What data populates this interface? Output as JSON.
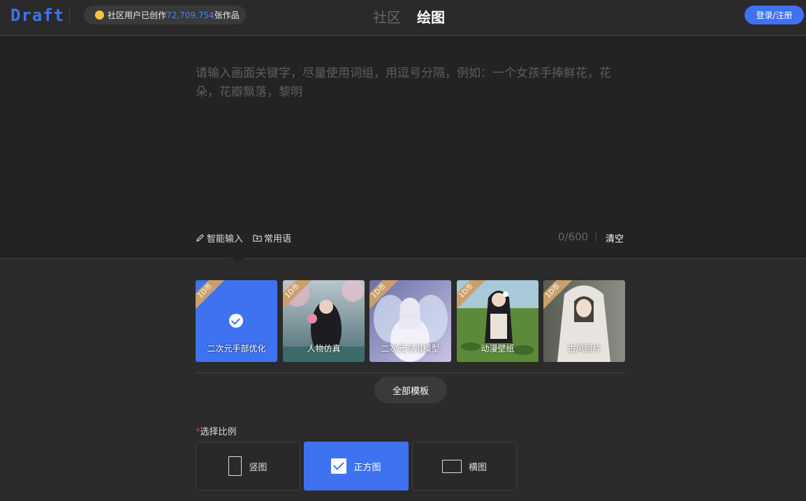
{
  "header": {
    "logo": "Draft",
    "stats_prefix": "社区用户已创作",
    "stats_count": "72,709,754",
    "stats_suffix": "张作品",
    "tabs": [
      {
        "label": "社区",
        "active": false
      },
      {
        "label": "绘图",
        "active": true
      }
    ],
    "login_label": "登录/注册"
  },
  "prompt": {
    "placeholder": "请输入画面关键字，尽量使用词组，用逗号分隔，例如：一个女孩手捧鲜花，花朵，花瓣飘落，黎明",
    "value": "",
    "smart_input_label": "智能输入",
    "phrases_label": "常用语",
    "counter": "0/600",
    "clear_label": "清空"
  },
  "templates": {
    "items": [
      {
        "label": "二次元手部优化",
        "badge": "1D币",
        "selected": true
      },
      {
        "label": "人物仿真",
        "badge": "1D币",
        "selected": false
      },
      {
        "label": "二次元专用模型",
        "badge": "1D币",
        "selected": false
      },
      {
        "label": "动漫壁纸",
        "badge": "1D币",
        "selected": false
      },
      {
        "label": "古风照片",
        "badge": "1D币",
        "selected": false
      }
    ],
    "all_label": "全部模板"
  },
  "ratio": {
    "required_mark": "*",
    "title": "选择比例",
    "options": [
      {
        "label": "竖图",
        "active": false
      },
      {
        "label": "正方图",
        "active": true
      },
      {
        "label": "横图",
        "active": false
      }
    ]
  },
  "colors": {
    "accent": "#3e72f0",
    "background": "#2b2b2b",
    "prompt_background": "#232323",
    "badge": "#c9a06b"
  }
}
